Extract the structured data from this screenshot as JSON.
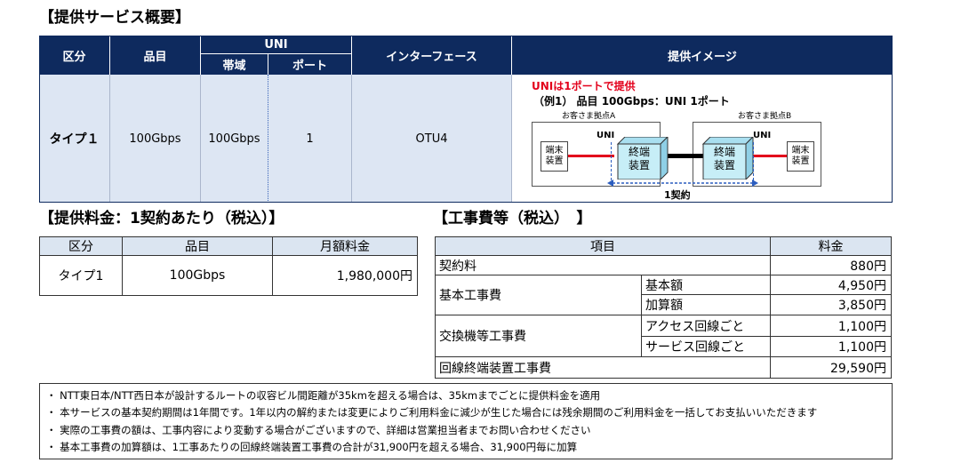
{
  "overview": {
    "title": "【提供サービス概要】",
    "headers": {
      "category": "区分",
      "item": "品目",
      "uni": "UNI",
      "bandwidth": "帯域",
      "port": "ポート",
      "interface": "インターフェース",
      "image": "提供イメージ"
    },
    "row": {
      "category": "タイプ１",
      "item": "100Gbps",
      "bandwidth": "100Gbps",
      "port": "1",
      "interface": "OTU4"
    },
    "diagram": {
      "headline": "UNIは1ポートで提供",
      "example": "（例1） 品目 100Gbps：UNI 1ポート",
      "site_a": "お客さま拠点A",
      "site_b": "お客さま拠点B",
      "uni_label": "UNI",
      "customer_device": "端末\n装置",
      "terminal_device": "終端\n装置",
      "contract": "1契約"
    }
  },
  "fee": {
    "title": "【提供料金：1契約あたり（税込）】",
    "headers": [
      "区分",
      "品目",
      "月額料金"
    ],
    "row": [
      "タイプ1",
      "100Gbps",
      "1,980,000円"
    ]
  },
  "construction": {
    "title": "【工事費等（税込）　】",
    "headers": {
      "item": "項目",
      "price": "料金"
    },
    "rows": {
      "contract_fee": {
        "label": "契約料",
        "price": "880円"
      },
      "basic": {
        "label": "基本工事費",
        "base_label": "基本額",
        "base_price": "4,950円",
        "add_label": "加算額",
        "add_price": "3,850円"
      },
      "exchange": {
        "label": "交換機等工事費",
        "access_label": "アクセス回線ごと",
        "access_price": "1,100円",
        "service_label": "サービス回線ごと",
        "service_price": "1,100円"
      },
      "terminal": {
        "label": "回線終端装置工事費",
        "price": "29,590円"
      }
    }
  },
  "notes": [
    "・ NTT東日本/NTT西日本が設計するルートの収容ビル間距離が35kmを超える場合は、35kmまでごとに提供料金を適用",
    "・ 本サービスの基本契約期間は1年間です。1年以内の解約または変更によりご利用料金に減少が生じた場合には残余期間のご利用料金を一括してお支払いいただきます",
    "・ 実際の工事費の額は、工事内容により変動する場合がございますので、詳細は営業担当者までお問い合わせください",
    "・ 基本工事費の加算額は、1工事あたりの回線終端装置工事費の合計が31,900円を超える場合、31,900円毎に加算"
  ],
  "colors": {
    "header_navy": "#0e2a5e",
    "body_blue": "#dde6f3",
    "fee_header": "#dbe5f1",
    "accent_red": "#e3001b",
    "device_cyan": "#c7eef7"
  }
}
